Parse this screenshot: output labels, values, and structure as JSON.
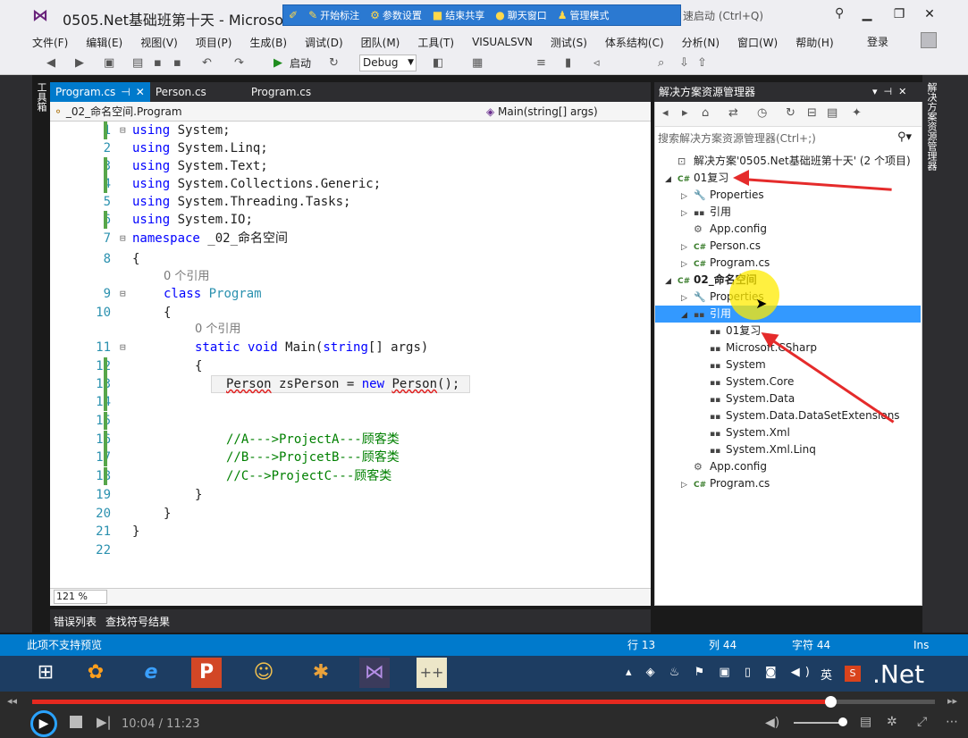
{
  "window": {
    "title": "0505.Net基础班第十天 - Microsoft",
    "quick_launch": "速启动 (Ctrl+Q)",
    "login": "登录"
  },
  "recording_bar": {
    "items": [
      "开始标注",
      "参数设置",
      "结束共享",
      "聊天窗口",
      "管理模式"
    ]
  },
  "menus": [
    "文件(F)",
    "编辑(E)",
    "视图(V)",
    "项目(P)",
    "生成(B)",
    "调试(D)",
    "团队(M)",
    "工具(T)",
    "VISUALSVN",
    "测试(S)",
    "体系结构(C)",
    "分析(N)",
    "窗口(W)",
    "帮助(H)"
  ],
  "toolbar": {
    "start_label": "启动",
    "config": "Debug"
  },
  "toolbox_tab": "工具箱",
  "editor": {
    "tabs": [
      "Program.cs",
      "Person.cs",
      "Program.cs"
    ],
    "nav_left": "_02_命名空间.Program",
    "nav_right": "Main(string[] args)",
    "zoom": "121 %",
    "lines": [
      {
        "n": "1",
        "text": "using System;"
      },
      {
        "n": "2",
        "text": "using System.Linq;"
      },
      {
        "n": "3",
        "text": "using System.Text;"
      },
      {
        "n": "4",
        "text": "using System.Collections.Generic;"
      },
      {
        "n": "5",
        "text": "using System.Threading.Tasks;"
      },
      {
        "n": "6",
        "text": "using System.IO;"
      },
      {
        "n": "7",
        "text": "namespace _02_命名空间"
      },
      {
        "n": "8",
        "text": "{"
      },
      {
        "n": "",
        "text": "0 个引用"
      },
      {
        "n": "9",
        "text": "class Program"
      },
      {
        "n": "10",
        "text": "{"
      },
      {
        "n": "",
        "text": "0 个引用"
      },
      {
        "n": "11",
        "text": "static void Main(string[] args)"
      },
      {
        "n": "12",
        "text": "{"
      },
      {
        "n": "13",
        "text": "Person zsPerson = new Person();"
      },
      {
        "n": "14",
        "text": ""
      },
      {
        "n": "15",
        "text": ""
      },
      {
        "n": "16",
        "text": "//A--->ProjectA---顾客类"
      },
      {
        "n": "17",
        "text": "//B--->ProjcetB---顾客类"
      },
      {
        "n": "18",
        "text": "//C-->ProjectC---顾客类"
      },
      {
        "n": "19",
        "text": "}"
      },
      {
        "n": "20",
        "text": "}"
      },
      {
        "n": "21",
        "text": "}"
      },
      {
        "n": "22",
        "text": ""
      }
    ]
  },
  "output_tabs": [
    "错误列表",
    "查找符号结果"
  ],
  "solution_explorer": {
    "title": "解决方案资源管理器",
    "search_placeholder": "搜索解决方案资源管理器(Ctrl+;)",
    "vertical_tab": "解决方案资源管理器",
    "nodes": [
      {
        "label": "解决方案'0505.Net基础班第十天' (2 个项目)",
        "icon": "solution-icon",
        "exp": ""
      },
      {
        "label": "01复习",
        "icon": "csharp-project-icon",
        "exp": "◢"
      },
      {
        "label": "Properties",
        "icon": "wrench-icon",
        "exp": "▷"
      },
      {
        "label": "引用",
        "icon": "references-icon",
        "exp": "▷"
      },
      {
        "label": "App.config",
        "icon": "config-icon",
        "exp": ""
      },
      {
        "label": "Person.cs",
        "icon": "csharp-file-icon",
        "exp": "▷"
      },
      {
        "label": "Program.cs",
        "icon": "csharp-file-icon",
        "exp": "▷"
      },
      {
        "label": "02_命名空间",
        "icon": "csharp-project-icon",
        "exp": "◢"
      },
      {
        "label": "Properties",
        "icon": "wrench-icon",
        "exp": "▷"
      },
      {
        "label": "引用",
        "icon": "references-icon",
        "exp": "◢"
      },
      {
        "label": "01复习",
        "icon": "reference-icon",
        "exp": ""
      },
      {
        "label": "Microsoft.CSharp",
        "icon": "reference-icon",
        "exp": ""
      },
      {
        "label": "System",
        "icon": "reference-icon",
        "exp": ""
      },
      {
        "label": "System.Core",
        "icon": "reference-icon",
        "exp": ""
      },
      {
        "label": "System.Data",
        "icon": "reference-icon",
        "exp": ""
      },
      {
        "label": "System.Data.DataSetExtensions",
        "icon": "reference-icon",
        "exp": ""
      },
      {
        "label": "System.Xml",
        "icon": "reference-icon",
        "exp": ""
      },
      {
        "label": "System.Xml.Linq",
        "icon": "reference-icon",
        "exp": ""
      },
      {
        "label": "App.config",
        "icon": "config-icon",
        "exp": ""
      },
      {
        "label": "Program.cs",
        "icon": "csharp-file-icon",
        "exp": "▷"
      }
    ]
  },
  "statusbar": {
    "left": "此项不支持预览",
    "row": "行 13",
    "col": "列 44",
    "char": "字符 44",
    "mode": "Ins"
  },
  "taskbar": {
    "tray_ime": "英",
    "brand": ".Net"
  },
  "player": {
    "time": "10:04 / 11:23",
    "progress": 0.884
  },
  "colors": {
    "accent": "#007acc",
    "progress": "#e5291f",
    "annotation_arrow": "#e52b2b"
  }
}
